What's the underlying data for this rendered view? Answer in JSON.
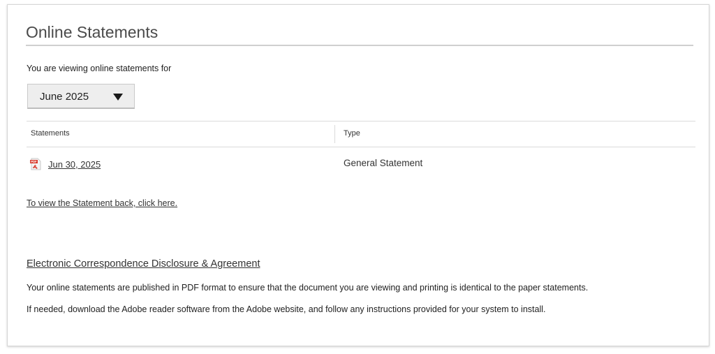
{
  "page": {
    "title": "Online Statements",
    "viewing_label": "You are viewing online statements for",
    "month_select": {
      "selected": "June 2025"
    }
  },
  "table": {
    "headers": [
      "Statements",
      "Type"
    ],
    "rows": [
      {
        "date": "Jun 30, 2025",
        "type": "General Statement",
        "icon": "pdf-icon"
      }
    ]
  },
  "links": {
    "statement_back": "To view the Statement back, click here.",
    "disclosure": "Electronic Correspondence Disclosure & Agreement"
  },
  "notes": [
    "Your online statements are published in PDF format to ensure that the document you are viewing and printing is identical to the paper statements.",
    "If needed, download the Adobe reader software from the Adobe website, and follow any instructions provided for your system to install."
  ],
  "colors": {
    "pdf_red": "#d83a2c"
  }
}
